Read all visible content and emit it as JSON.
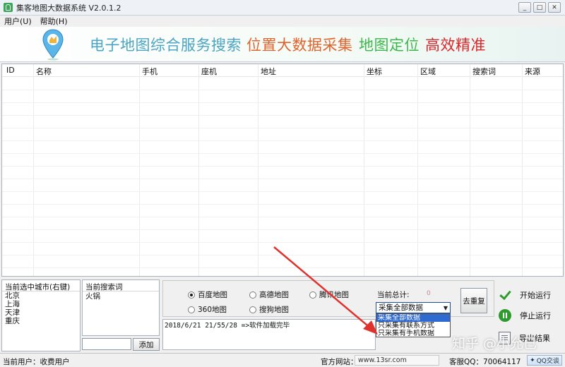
{
  "window": {
    "title": "集客地图大数据系统 V2.0.1.2",
    "controls": [
      "_",
      "□",
      "✕"
    ]
  },
  "menu": {
    "items": [
      {
        "label": "用户(U)"
      },
      {
        "label": "帮助(H)"
      }
    ]
  },
  "banner": {
    "slogans": [
      {
        "text": "电子地图综合服务搜索",
        "color": "#4aa5c3"
      },
      {
        "text": "位置大数据采集",
        "color": "#e0632c"
      },
      {
        "text": "地图定位",
        "color": "#3cb84a"
      },
      {
        "text": "高效精准",
        "color": "#d9262a"
      }
    ]
  },
  "table": {
    "columns": [
      "ID",
      "名称",
      "手机",
      "座机",
      "地址",
      "坐标",
      "区域",
      "搜索词",
      "来源"
    ],
    "rows": []
  },
  "city_panel": {
    "header": "当前选中城市(右键)",
    "cities": [
      "北京",
      "上海",
      "天津",
      "重庆"
    ]
  },
  "keyword_panel": {
    "header": "当前搜索词",
    "keywords": [
      "火锅"
    ],
    "input_value": "",
    "add_label": "添加"
  },
  "map_sources": [
    {
      "label": "百度地图",
      "selected": true
    },
    {
      "label": "高德地图",
      "selected": false
    },
    {
      "label": "腾讯地图",
      "selected": false
    },
    {
      "label": "360地图",
      "selected": false
    },
    {
      "label": "搜狗地图",
      "selected": false
    }
  ],
  "stats": {
    "total_label": "当前总计:",
    "total_value": "0"
  },
  "collect_mode": {
    "selected": "采集全部数据",
    "options": [
      "采集全部数据",
      "只采集有联系方式",
      "只采集有手机数据"
    ]
  },
  "log": {
    "lines": [
      "2018/6/21 21/55/28 =>软件加载完毕"
    ]
  },
  "buttons": {
    "dedupe": "去重复",
    "start": "开始运行",
    "stop": "停止运行",
    "export": "导出结果"
  },
  "status": {
    "user_text": "当前用户：收费用户",
    "website_label": "官方网站：",
    "website_value": "www.13sr.com",
    "support_label": "客服QQ：70064117",
    "qq_button": "QQ交谈"
  },
  "watermark": "知乎 @小允已"
}
